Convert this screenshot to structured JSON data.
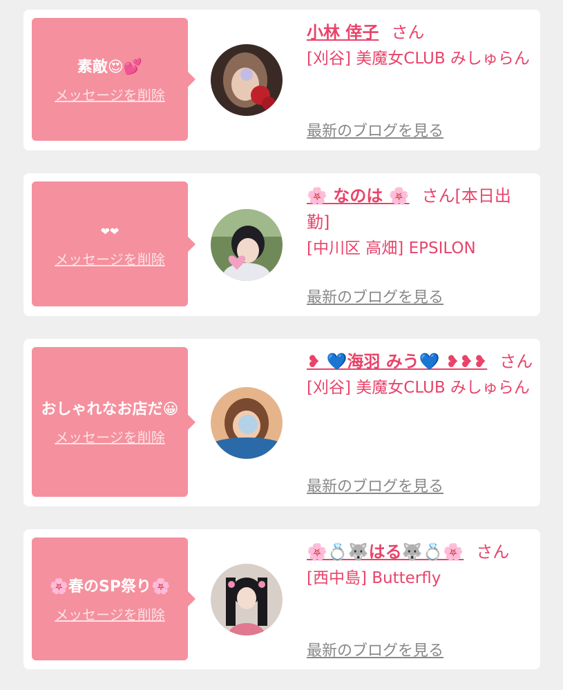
{
  "colors": {
    "accent": "#e8436a",
    "bubble": "#f5909e",
    "link_gray": "#888888"
  },
  "items": [
    {
      "message": "素敵😍💕",
      "delete_label": "メッセージを削除",
      "name": "小林 倖子",
      "suffix": "さん",
      "shop": "[刈谷] 美魔女CLUB みしゅらん",
      "blog_label": "最新のブログを見る"
    },
    {
      "message": "❤❤",
      "delete_label": "メッセージを削除",
      "name": "🌸 なのは 🌸",
      "suffix": "さん[本日出勤]",
      "shop": "[中川区 高畑] EPSILON",
      "blog_label": "最新のブログを見る"
    },
    {
      "message": "おしゃれなお店だ😀",
      "delete_label": "メッセージを削除",
      "name": "❥ 💙海羽 みう💙 ❥❥❥",
      "suffix": "さん",
      "shop": "[刈谷] 美魔女CLUB みしゅらん",
      "blog_label": "最新のブログを見る"
    },
    {
      "message": "🌸春のSP祭り🌸",
      "delete_label": "メッセージを削除",
      "name": "🌸💍🐺はる🐺💍🌸",
      "suffix": "さん",
      "shop": "[西中島] Butterfly",
      "blog_label": "最新のブログを見る"
    }
  ]
}
